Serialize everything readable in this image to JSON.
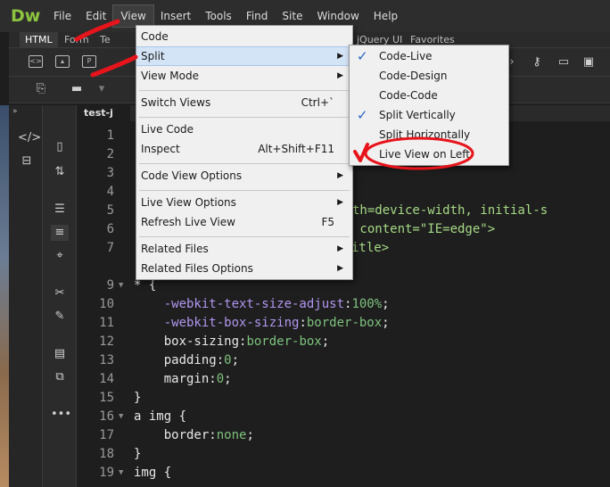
{
  "app": {
    "logo": "Dw"
  },
  "menubar": {
    "items": [
      "File",
      "Edit",
      "View",
      "Insert",
      "Tools",
      "Find",
      "Site",
      "Window",
      "Help"
    ]
  },
  "insert_tabs": [
    "HTML",
    "Form",
    "Te",
    "jQuery UI",
    "Favorites"
  ],
  "document": {
    "tab": "test-j"
  },
  "view_menu": {
    "items": [
      {
        "label": "Code",
        "shortcut": "",
        "submenu": false
      },
      {
        "label": "Split",
        "shortcut": "",
        "submenu": true
      },
      {
        "label": "View Mode",
        "shortcut": "",
        "submenu": true
      },
      {
        "label": "Switch Views",
        "shortcut": "Ctrl+`",
        "submenu": false
      },
      {
        "label": "Live Code",
        "shortcut": "",
        "submenu": false
      },
      {
        "label": "Inspect",
        "shortcut": "Alt+Shift+F11",
        "submenu": false
      },
      {
        "label": "Code View Options",
        "shortcut": "",
        "submenu": true
      },
      {
        "label": "Live View Options",
        "shortcut": "",
        "submenu": true
      },
      {
        "label": "Refresh Live View",
        "shortcut": "F5",
        "submenu": false
      },
      {
        "label": "Related Files",
        "shortcut": "",
        "submenu": true
      },
      {
        "label": "Related Files Options",
        "shortcut": "",
        "submenu": true
      }
    ]
  },
  "split_submenu": {
    "items": [
      {
        "label": "Code-Live",
        "checked": true
      },
      {
        "label": "Code-Design",
        "checked": false
      },
      {
        "label": "Code-Code",
        "checked": false
      },
      {
        "label": "Split Vertically",
        "checked": true
      },
      {
        "label": "Split Horizontally",
        "checked": false
      },
      {
        "label": "Live View on Left",
        "checked": false
      }
    ]
  },
  "code": {
    "partial_top": [
      {
        "ln": "1"
      },
      {
        "ln": "2"
      },
      {
        "ln": "3"
      },
      {
        "ln": "4"
      },
      {
        "ln": "5",
        "text": "nt=\"width=device-width, initial-s"
      },
      {
        "ln": "6",
        "text": "atible\" content=\"IE=edge\">"
      },
      {
        "ln": "7",
        "text": "itle>"
      }
    ],
    "lines": [
      {
        "ln": "9",
        "fold": true,
        "parts": [
          [
            "plain",
            "* {"
          ]
        ]
      },
      {
        "ln": "10",
        "fold": false,
        "parts": [
          [
            "plain",
            "    "
          ],
          [
            "prop",
            "-webkit-text-size-adjust"
          ],
          [
            "plain",
            ":"
          ],
          [
            "val",
            "100%"
          ],
          [
            "plain",
            ";"
          ]
        ]
      },
      {
        "ln": "11",
        "fold": false,
        "parts": [
          [
            "plain",
            "    "
          ],
          [
            "prop",
            "-webkit-box-sizing"
          ],
          [
            "plain",
            ":"
          ],
          [
            "val",
            "border-box"
          ],
          [
            "plain",
            ";"
          ]
        ]
      },
      {
        "ln": "12",
        "fold": false,
        "parts": [
          [
            "plain",
            "    box-sizing:"
          ],
          [
            "val",
            "border-box"
          ],
          [
            "plain",
            ";"
          ]
        ]
      },
      {
        "ln": "13",
        "fold": false,
        "parts": [
          [
            "plain",
            "    padding:"
          ],
          [
            "val",
            "0"
          ],
          [
            "plain",
            ";"
          ]
        ]
      },
      {
        "ln": "14",
        "fold": false,
        "parts": [
          [
            "plain",
            "    margin:"
          ],
          [
            "val",
            "0"
          ],
          [
            "plain",
            ";"
          ]
        ]
      },
      {
        "ln": "15",
        "fold": false,
        "parts": [
          [
            "plain",
            "}"
          ]
        ]
      },
      {
        "ln": "16",
        "fold": true,
        "parts": [
          [
            "plain",
            "a img {"
          ]
        ]
      },
      {
        "ln": "17",
        "fold": false,
        "parts": [
          [
            "plain",
            "    border:"
          ],
          [
            "val",
            "none"
          ],
          [
            "plain",
            ";"
          ]
        ]
      },
      {
        "ln": "18",
        "fold": false,
        "parts": [
          [
            "plain",
            "}"
          ]
        ]
      },
      {
        "ln": "19",
        "fold": true,
        "parts": [
          [
            "plain",
            "img {"
          ]
        ]
      }
    ]
  },
  "colors": {
    "annotation": "#e8141c",
    "check": "#2a63c9",
    "logo": "#8cc43f"
  }
}
